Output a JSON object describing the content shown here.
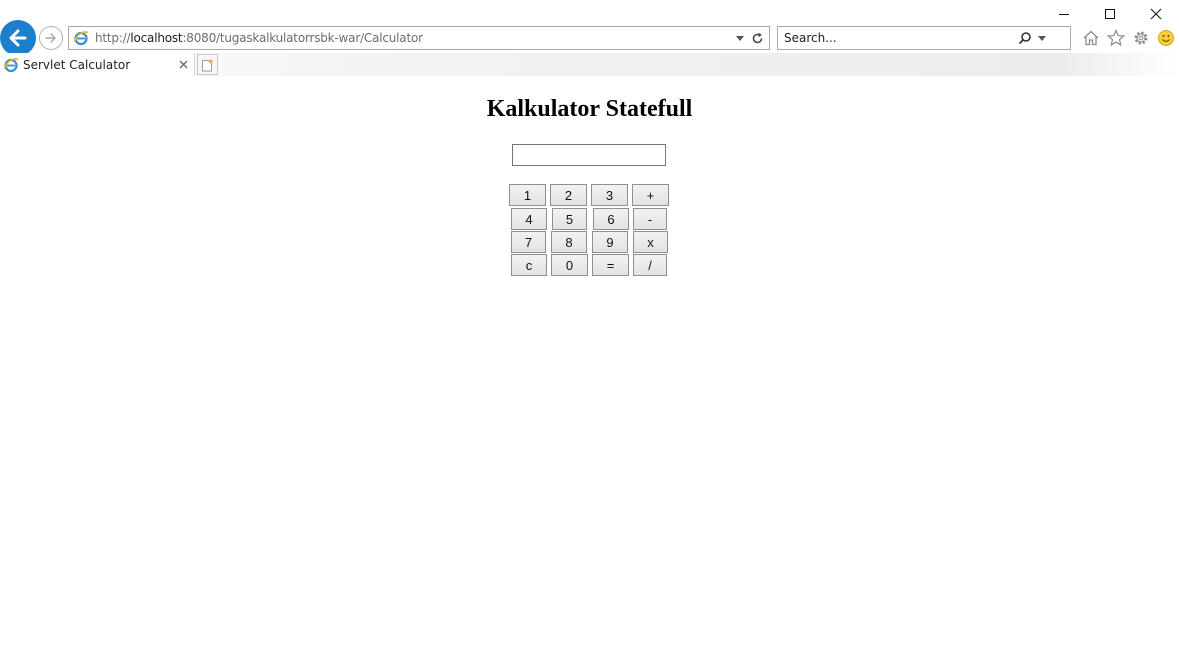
{
  "browser": {
    "url_scheme": "http://",
    "url_host": "localhost",
    "url_path": ":8080/tugaskalkulatorrsbk-war/Calculator",
    "search_placeholder": "Search...",
    "tab_title": "Servlet Calculator",
    "accent_color": "#1c7fcb"
  },
  "page": {
    "heading": "Kalkulator Statefull",
    "display_value": ""
  },
  "keypad": {
    "rows": [
      [
        "1",
        "2",
        "3",
        "+"
      ],
      [
        "4",
        "5",
        "6",
        "-"
      ],
      [
        "7",
        "8",
        "9",
        "x"
      ],
      [
        "c",
        "0",
        "=",
        "/"
      ]
    ]
  }
}
